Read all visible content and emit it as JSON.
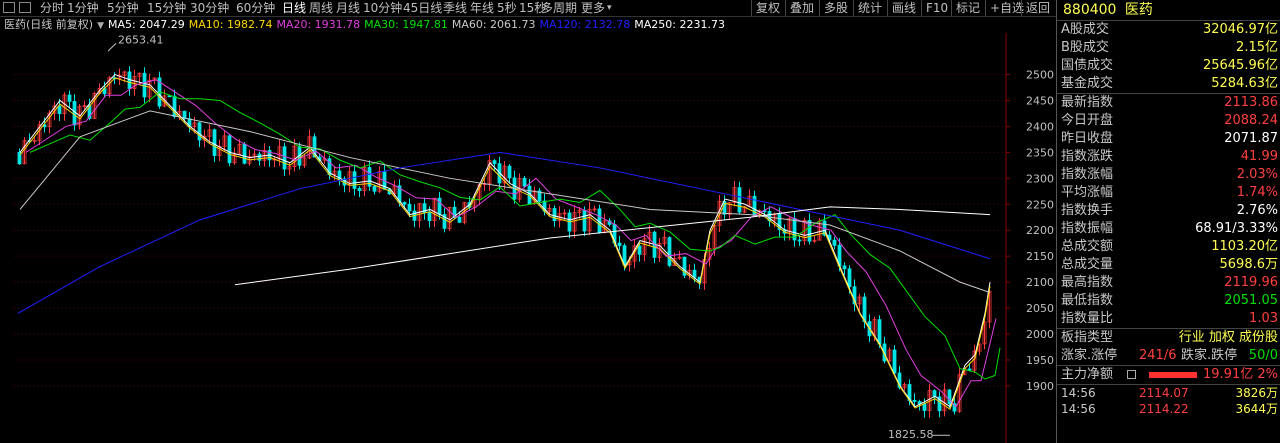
{
  "toolbar": {
    "items": [
      "分时",
      "1分钟",
      "5分钟",
      "15分钟",
      "30分钟",
      "60分钟",
      "日线",
      "周线",
      "月线",
      "10分钟",
      "45日线",
      "季线",
      "年线",
      "5秒",
      "15秒",
      "多周期",
      "更多"
    ],
    "active_index": 6,
    "right": [
      "复权",
      "叠加",
      "多股",
      "统计",
      "画线",
      "F10",
      "标记",
      "+自选",
      "返回"
    ]
  },
  "ma_bar": {
    "title": "医药(日线 前复权)",
    "items": [
      {
        "label": "MA5: 2047.29",
        "color": "#ffffff"
      },
      {
        "label": "MA10: 1982.74",
        "color": "#ffd700"
      },
      {
        "label": "MA20: 1931.78",
        "color": "#e040e0"
      },
      {
        "label": "MA30: 1947.81",
        "color": "#00e000"
      },
      {
        "label": "MA60: 2061.73",
        "color": "#c8c8c8"
      },
      {
        "label": "MA120: 2132.78",
        "color": "#2020ff"
      },
      {
        "label": "MA250: 2231.73",
        "color": "#ffffff"
      }
    ]
  },
  "chart_data": {
    "type": "candlestick",
    "y_ticks": [
      1900,
      1950,
      2000,
      2050,
      2100,
      2150,
      2200,
      2250,
      2300,
      2350,
      2400,
      2450,
      2500
    ],
    "ylim": [
      1790,
      2580
    ],
    "annotations": [
      {
        "text": "2653.41"
      },
      {
        "text": "1825.58"
      }
    ],
    "colors": {
      "up": "#ff3b3b",
      "down": "#00e5e5",
      "ma5": "#ffffff",
      "ma10": "#ffd700",
      "ma20": "#e040e0",
      "ma30": "#00e000",
      "ma60": "#c8c8c8",
      "ma120": "#2020ff",
      "ma250": "#ffffff"
    }
  },
  "panel": {
    "code": "880400",
    "name": "医药",
    "rows": [
      {
        "label": "A股成交",
        "value": "32046.97亿",
        "color": "#ffff54"
      },
      {
        "label": "B股成交",
        "value": "2.15亿",
        "color": "#ffff54"
      },
      {
        "label": "国债成交",
        "value": "25645.96亿",
        "color": "#ffff54"
      },
      {
        "label": "基金成交",
        "value": "5284.63亿",
        "color": "#ffff54"
      },
      {
        "label": "最新指数",
        "value": "2113.86",
        "color": "#ff4040",
        "sep": true
      },
      {
        "label": "今日开盘",
        "value": "2088.24",
        "color": "#ff4040"
      },
      {
        "label": "昨日收盘",
        "value": "2071.87",
        "color": "#ffffff"
      },
      {
        "label": "指数涨跌",
        "value": "41.99",
        "color": "#ff4040"
      },
      {
        "label": "指数涨幅",
        "value": "2.03%",
        "color": "#ff4040"
      },
      {
        "label": "平均涨幅",
        "value": "1.74%",
        "color": "#ff4040"
      },
      {
        "label": "指数换手",
        "value": "2.76%",
        "color": "#ffffff"
      },
      {
        "label": "指数振幅",
        "value": "68.91/3.33%",
        "color": "#ffffff"
      },
      {
        "label": "总成交额",
        "value": "1103.20亿",
        "color": "#ffff54"
      },
      {
        "label": "总成交量",
        "value": "5698.6万",
        "color": "#ffff54"
      },
      {
        "label": "最高指数",
        "value": "2119.96",
        "color": "#ff4040"
      },
      {
        "label": "最低指数",
        "value": "2051.05",
        "color": "#00e000"
      },
      {
        "label": "指数量比",
        "value": "1.03",
        "color": "#ff4040"
      }
    ],
    "board_type": {
      "label": "板指类型",
      "value": "行业 加权 成份股",
      "color": "#ffff54"
    },
    "updown": {
      "up_label": "涨家.涨停",
      "up_value": "241/6",
      "down_label": "跌家.跌停",
      "down_value": "50/0"
    },
    "netflow": {
      "label": "主力净额",
      "value": "19.91亿",
      "pct": "2%"
    },
    "ticks": [
      {
        "time": "14:56",
        "price": "2114.07",
        "vol": "3826万"
      },
      {
        "time": "14:56",
        "price": "2114.22",
        "vol": "3644万"
      }
    ]
  }
}
